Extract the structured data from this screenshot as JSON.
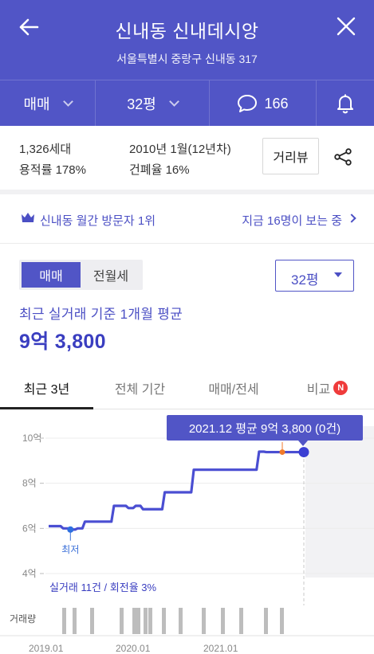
{
  "header": {
    "title": "신내동 신내데시앙",
    "address": "서울특별시 중랑구 신내동 317"
  },
  "filters": {
    "trade_type": "매매",
    "size": "32평",
    "comments": "166"
  },
  "info": {
    "households": "1,326세대",
    "floor_area_ratio": "용적률 178%",
    "built": "2010년 1월(12년차)",
    "coverage_ratio": "건폐율 16%",
    "distance_view_button": "거리뷰"
  },
  "visitors": {
    "rank_text": "신내동 월간 방문자 1위",
    "now_viewing": "지금 16명이 보는 중"
  },
  "price_panel": {
    "segment": [
      "매매",
      "전월세"
    ],
    "size_select": "32평",
    "avg_label": "최근 실거래 기준 1개월 평균",
    "avg_price": "9억 3,800"
  },
  "tabs": [
    "최근 3년",
    "전체 기간",
    "매매/전세",
    "비교"
  ],
  "tab_badge": "N",
  "colors": {
    "brand": "#5155c6",
    "badge": "#ef3b3b",
    "line": "#4a4ed2",
    "marker_orange": "#f07a2b"
  },
  "chart_data": {
    "type": "line",
    "tooltip": "2021.12 평균 9억 3,800 (0건)",
    "y_ticks": [
      "10억",
      "8억",
      "6억",
      "4억"
    ],
    "ylim": [
      4,
      10
    ],
    "x_ticks": [
      "2019.01",
      "2020.01",
      "2021.01"
    ],
    "min_label": "최저",
    "stats": "실거래 11건 / 회전율 3%",
    "volume_label": "거래량",
    "series": [
      {
        "points": [
          [
            "2019-01",
            6.1
          ],
          [
            "2019-02",
            6.1
          ],
          [
            "2019-03",
            6.0
          ],
          [
            "2019-04",
            5.95
          ],
          [
            "2019-05",
            6.0
          ],
          [
            "2019-06",
            6.3
          ],
          [
            "2019-07",
            6.3
          ],
          [
            "2019-08",
            6.3
          ],
          [
            "2019-09",
            6.3
          ],
          [
            "2019-10",
            7.0
          ],
          [
            "2019-11",
            7.0
          ],
          [
            "2019-12",
            6.9
          ],
          [
            "2020-01",
            7.0
          ],
          [
            "2020-02",
            6.85
          ],
          [
            "2020-03",
            6.85
          ],
          [
            "2020-04",
            6.85
          ],
          [
            "2020-05",
            7.6
          ],
          [
            "2020-06",
            7.6
          ],
          [
            "2020-07",
            7.6
          ],
          [
            "2020-08",
            7.6
          ],
          [
            "2020-09",
            8.6
          ],
          [
            "2020-10",
            8.6
          ],
          [
            "2020-11",
            8.6
          ],
          [
            "2020-12",
            8.6
          ],
          [
            "2021-01",
            8.6
          ],
          [
            "2021-02",
            8.6
          ],
          [
            "2021-03",
            8.6
          ],
          [
            "2021-04",
            8.6
          ],
          [
            "2021-05",
            8.6
          ],
          [
            "2021-06",
            9.4
          ],
          [
            "2021-07",
            9.38
          ],
          [
            "2021-08",
            9.38
          ]
        ]
      }
    ]
  }
}
